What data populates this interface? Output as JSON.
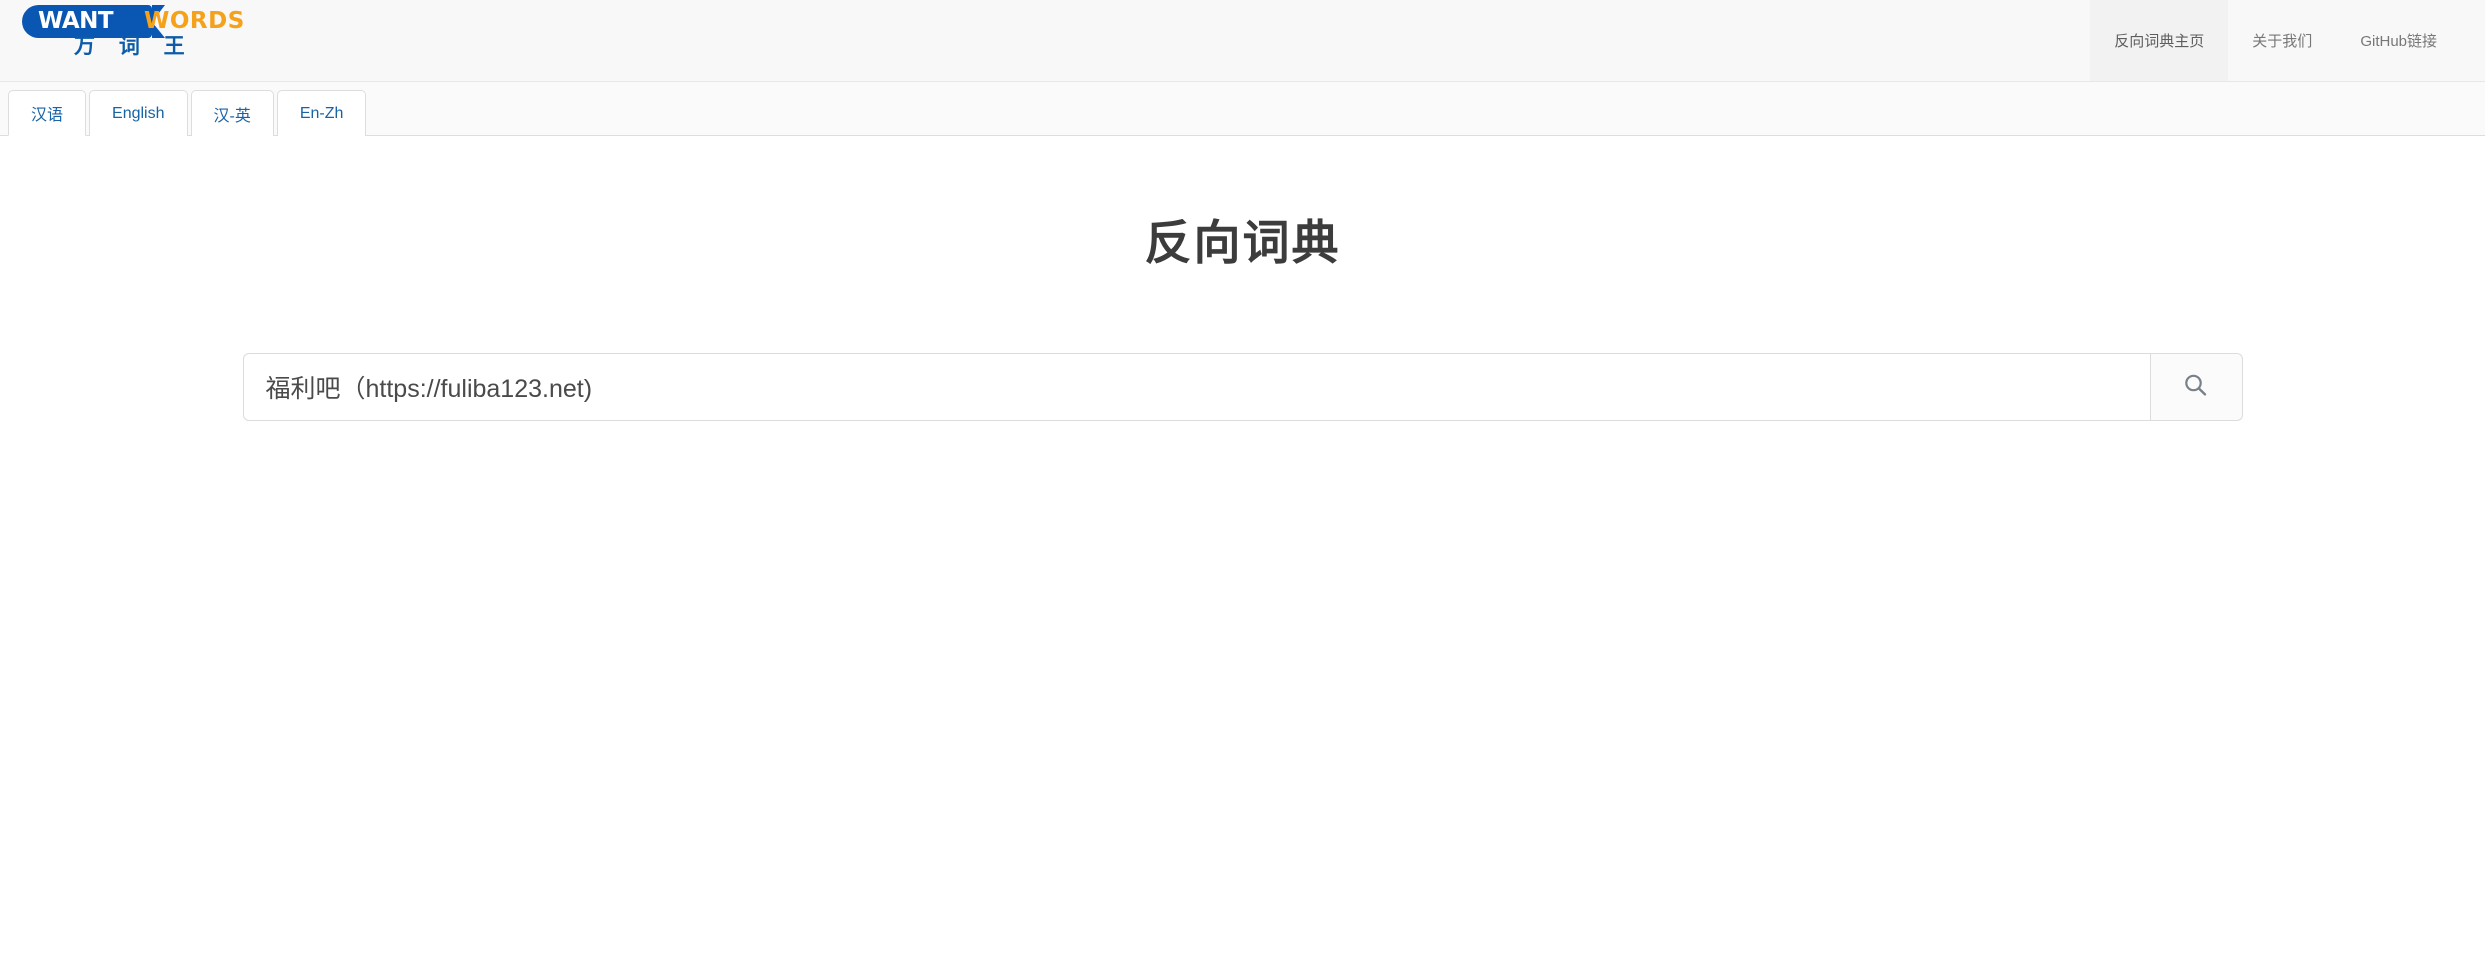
{
  "brand": {
    "want": "WANT",
    "words": "WORDS",
    "chinese": "万 词 王"
  },
  "nav": {
    "items": [
      {
        "label": "反向词典主页",
        "active": true
      },
      {
        "label": "关于我们",
        "active": false
      },
      {
        "label": "GitHub链接",
        "active": false
      }
    ]
  },
  "tabs": [
    {
      "label": "汉语",
      "active": true
    },
    {
      "label": "English",
      "active": false
    },
    {
      "label": "汉-英",
      "active": false
    },
    {
      "label": "En-Zh",
      "active": false
    }
  ],
  "main": {
    "title": "反向词典"
  },
  "search": {
    "value": "福利吧（https://fuliba123.net)",
    "placeholder": "",
    "button_icon": "search-icon"
  },
  "colors": {
    "brand_blue": "#0a57b3",
    "brand_orange": "#f5a11a",
    "tab_link": "#1763a6",
    "header_bg": "#f8f8f8",
    "title_text": "#3c3c3c"
  }
}
